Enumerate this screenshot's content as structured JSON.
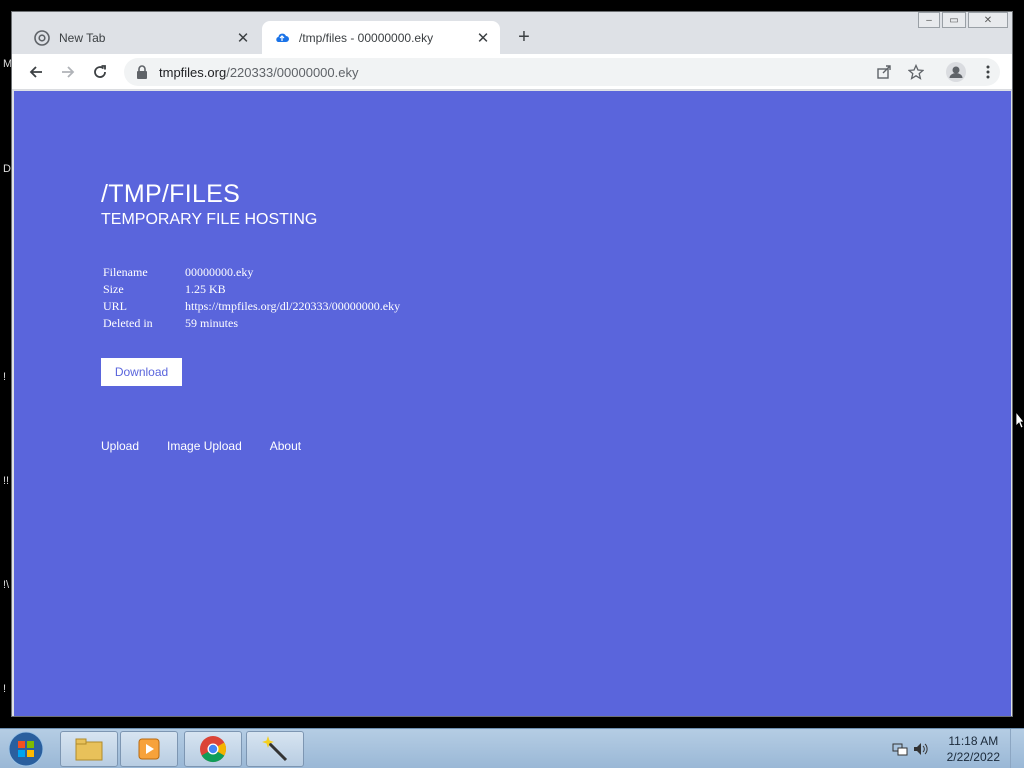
{
  "browser": {
    "tabs": [
      {
        "title": "New Tab",
        "icon": "chrome-icon",
        "active": false
      },
      {
        "title": "/tmp/files - 00000000.eky",
        "icon": "cloud-upload-icon",
        "active": true
      }
    ],
    "address": {
      "domain": "tmpfiles.org",
      "path": "/220333/00000000.eky"
    }
  },
  "page": {
    "title": "/TMP/FILES",
    "subtitle": "TEMPORARY FILE HOSTING",
    "info": [
      {
        "label": "Filename",
        "value": "00000000.eky"
      },
      {
        "label": "Size",
        "value": "1.25 KB"
      },
      {
        "label": "URL",
        "value": "https://tmpfiles.org/dl/220333/00000000.eky"
      },
      {
        "label": "Deleted in",
        "value": "59 minutes"
      }
    ],
    "download_label": "Download",
    "nav": [
      {
        "label": "Upload"
      },
      {
        "label": "Image Upload"
      },
      {
        "label": "About"
      }
    ],
    "background_color": "#5a65dc"
  },
  "desktop": {
    "edge_glyphs": [
      "M",
      "D",
      "!",
      "!!",
      "!\\",
      "!"
    ]
  },
  "taskbar": {
    "clock_time": "11:18 AM",
    "clock_date": "2/22/2022"
  }
}
